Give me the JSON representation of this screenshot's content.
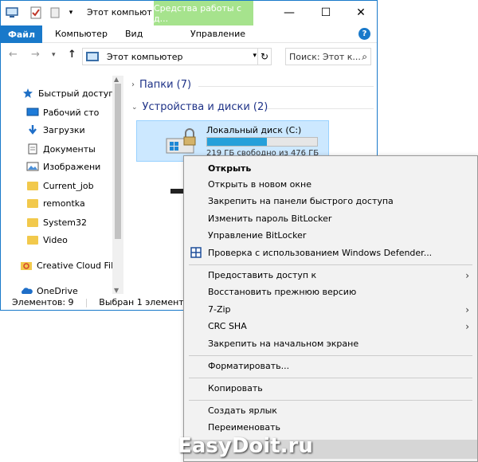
{
  "window": {
    "title": "Этот компьют",
    "tools_tab": "Средства работы с д...",
    "min_label": "—",
    "max_label": "☐",
    "close_label": "✕"
  },
  "ribbon": {
    "file": "Файл",
    "computer": "Компьютер",
    "view": "Вид",
    "manage": "Управление",
    "help": "?"
  },
  "nav": {
    "back": "←",
    "forward": "→",
    "recent": "▾",
    "up": "↑",
    "address": "Этот компьютер",
    "address_dropdown": "▾",
    "refresh": "↻",
    "search_placeholder": "Поиск: Этот к...",
    "search_icon": "⌕"
  },
  "navpane": {
    "items": [
      {
        "label": "Быстрый доступ",
        "icon": "star-icon",
        "pinned": false
      },
      {
        "label": "Рабочий сто",
        "icon": "desktop-icon",
        "pinned": true
      },
      {
        "label": "Загрузки",
        "icon": "download-icon",
        "pinned": true
      },
      {
        "label": "Документы",
        "icon": "document-icon",
        "pinned": true
      },
      {
        "label": "Изображени",
        "icon": "pictures-icon",
        "pinned": true
      },
      {
        "label": "Current_job",
        "icon": "folder-icon",
        "pinned": false
      },
      {
        "label": "remontka",
        "icon": "folder-icon",
        "pinned": false
      },
      {
        "label": "System32",
        "icon": "folder-icon",
        "pinned": false
      },
      {
        "label": "Video",
        "icon": "folder-icon",
        "pinned": false
      },
      {
        "label": "Creative Cloud Fil",
        "icon": "creative-cloud-icon",
        "pinned": false
      },
      {
        "label": "OneDrive",
        "icon": "onedrive-icon",
        "pinned": false
      }
    ]
  },
  "content": {
    "folders_group": "Папки (7)",
    "devices_group": "Устройства и диски (2)",
    "drive": {
      "name": "Локальный диск (C:)",
      "free": "219 ГБ свободно из 476 ГБ",
      "used_fraction": 0.54
    }
  },
  "status": {
    "items": "Элементов: 9",
    "selected": "Выбран 1 элемент"
  },
  "context_menu": {
    "items": [
      {
        "label": "Открыть",
        "bold": true,
        "submenu": false
      },
      {
        "label": "Открыть в новом окне",
        "bold": false,
        "submenu": false
      },
      {
        "label": "Закрепить на панели быстрого доступа",
        "bold": false,
        "submenu": false
      },
      {
        "label": "Изменить пароль BitLocker",
        "bold": false,
        "submenu": false
      },
      {
        "label": "Управление BitLocker",
        "bold": false,
        "submenu": false
      },
      {
        "label": "Проверка с использованием Windows Defender...",
        "bold": false,
        "submenu": false
      },
      {
        "label": "Предоставить доступ к",
        "bold": false,
        "submenu": true
      },
      {
        "label": "Восстановить прежнюю версию",
        "bold": false,
        "submenu": false
      },
      {
        "label": "7-Zip",
        "bold": false,
        "submenu": true
      },
      {
        "label": "CRC SHA",
        "bold": false,
        "submenu": true
      },
      {
        "label": "Закрепить на начальном экране",
        "bold": false,
        "submenu": false
      },
      {
        "label": "Форматировать...",
        "bold": false,
        "submenu": false
      },
      {
        "label": "Копировать",
        "bold": false,
        "submenu": false
      },
      {
        "label": "Создать ярлык",
        "bold": false,
        "submenu": false
      },
      {
        "label": "Переименовать",
        "bold": false,
        "submenu": false
      }
    ],
    "submenu_arrow": "›"
  },
  "watermark": "EasyDoit.ru",
  "colors": {
    "accent": "#1979ca",
    "tools_tab": "#a6e38d",
    "selection": "#cce8ff",
    "progress": "#26a0da"
  }
}
